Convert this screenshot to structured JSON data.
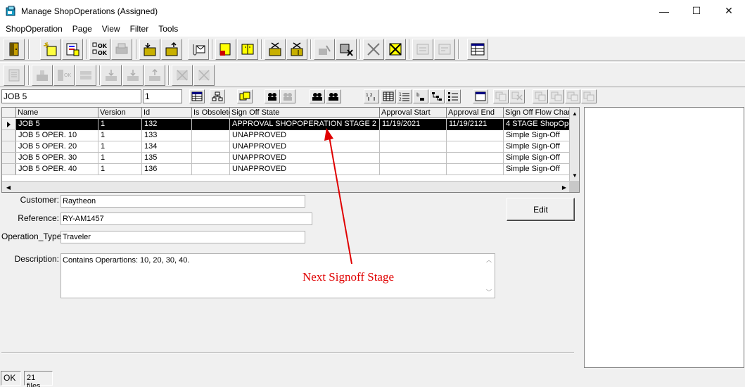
{
  "window": {
    "title": "Manage ShopOperations (Assigned)",
    "minimize_glyph": "—",
    "maximize_glyph": "☐",
    "close_glyph": "✕"
  },
  "menu": [
    {
      "label": "ShopOperation"
    },
    {
      "label": "Page"
    },
    {
      "label": "View"
    },
    {
      "label": "Filter"
    },
    {
      "label": "Tools"
    }
  ],
  "filter": {
    "name_value": "JOB 5",
    "version_value": "1"
  },
  "grid": {
    "columns": [
      "Name",
      "Version",
      "Id",
      "Is Obsolete",
      "Sign Off State",
      "Approval Start",
      "Approval End",
      "Sign Off Flow Char"
    ],
    "rows": [
      {
        "name": "JOB 5",
        "version": "1",
        "id": "132",
        "obsolete": "",
        "state": "APPROVAL SHOPOPERATION STAGE 2",
        "start": "11/19/2021",
        "end": "11/19/2121",
        "flow": "4 STAGE ShopOpe",
        "selected": true
      },
      {
        "name": "JOB 5 OPER. 10",
        "version": "1",
        "id": "133",
        "obsolete": "",
        "state": "UNAPPROVED",
        "start": "",
        "end": "",
        "flow": "Simple Sign-Off",
        "selected": false
      },
      {
        "name": "JOB 5 OPER. 20",
        "version": "1",
        "id": "134",
        "obsolete": "",
        "state": "UNAPPROVED",
        "start": "",
        "end": "",
        "flow": "Simple Sign-Off",
        "selected": false
      },
      {
        "name": "JOB 5 OPER. 30",
        "version": "1",
        "id": "135",
        "obsolete": "",
        "state": "UNAPPROVED",
        "start": "",
        "end": "",
        "flow": "Simple Sign-Off",
        "selected": false
      },
      {
        "name": "JOB 5 OPER. 40",
        "version": "1",
        "id": "136",
        "obsolete": "",
        "state": "UNAPPROVED",
        "start": "",
        "end": "",
        "flow": "Simple Sign-Off",
        "selected": false
      }
    ]
  },
  "details": {
    "customer_label": "Customer:",
    "customer_value": "Raytheon",
    "reference_label": "Reference:",
    "reference_value": "RY-AM1457",
    "operation_type_label": "Operation_Type:",
    "operation_type_value": "Traveler",
    "description_label": "Description:",
    "description_value": "Contains Operartions: 10, 20, 30, 40.",
    "edit_button": "Edit"
  },
  "annotation": {
    "text": "Next Signoff Stage",
    "color": "#e00000"
  },
  "status": {
    "state": "OK",
    "files": "21 files."
  }
}
